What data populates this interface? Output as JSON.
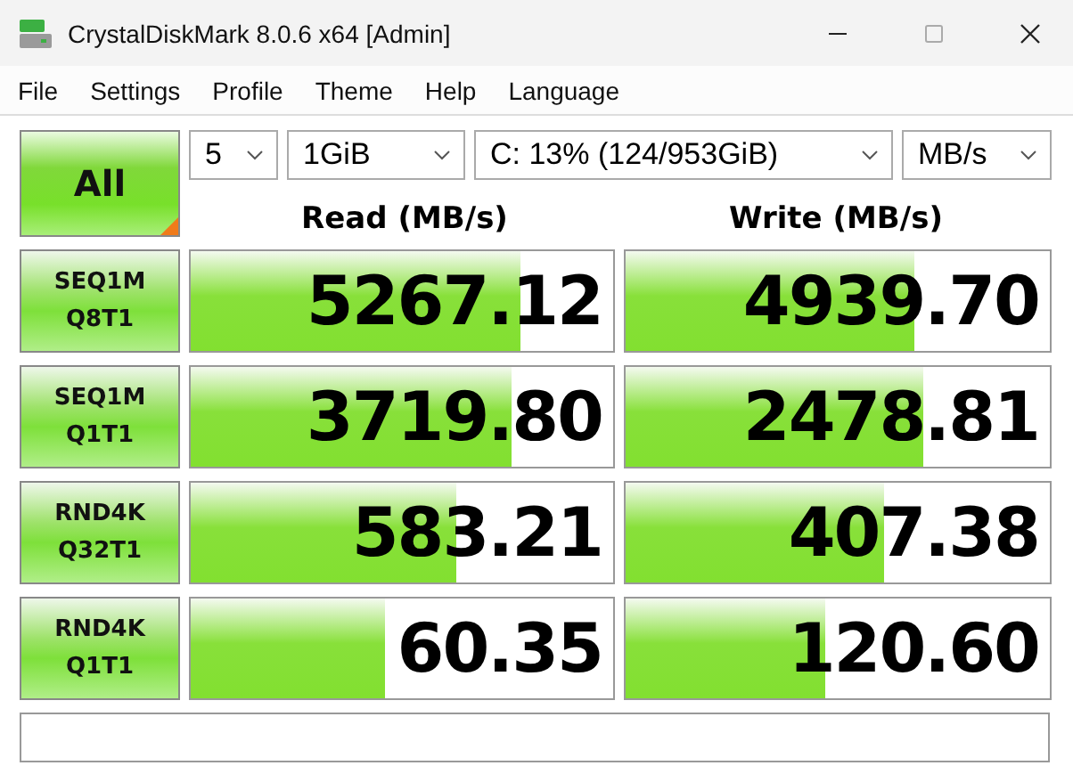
{
  "window": {
    "title": "CrystalDiskMark 8.0.6 x64 [Admin]"
  },
  "menu": [
    "File",
    "Settings",
    "Profile",
    "Theme",
    "Help",
    "Language"
  ],
  "all_button": {
    "label": "All"
  },
  "selectors": [
    {
      "value": "5"
    },
    {
      "value": "1GiB"
    },
    {
      "value": "C: 13% (124/953GiB)"
    },
    {
      "value": "MB/s"
    }
  ],
  "columns": [
    "Read (MB/s)",
    "Write (MB/s)"
  ],
  "tests": [
    {
      "label": [
        "SEQ1M",
        "Q8T1"
      ],
      "read": {
        "value": "5267.12",
        "level": 0.78
      },
      "write": {
        "value": "4939.70",
        "level": 0.68
      }
    },
    {
      "label": [
        "SEQ1M",
        "Q1T1"
      ],
      "read": {
        "value": "3719.80",
        "level": 0.76
      },
      "write": {
        "value": "2478.81",
        "level": 0.7
      }
    },
    {
      "label": [
        "RND4K",
        "Q32T1"
      ],
      "read": {
        "value": "583.21",
        "level": 0.63
      },
      "write": {
        "value": "407.38",
        "level": 0.61
      }
    },
    {
      "label": [
        "RND4K",
        "Q1T1"
      ],
      "read": {
        "value": "60.35",
        "level": 0.46
      },
      "write": {
        "value": "120.60",
        "level": 0.47
      }
    }
  ]
}
